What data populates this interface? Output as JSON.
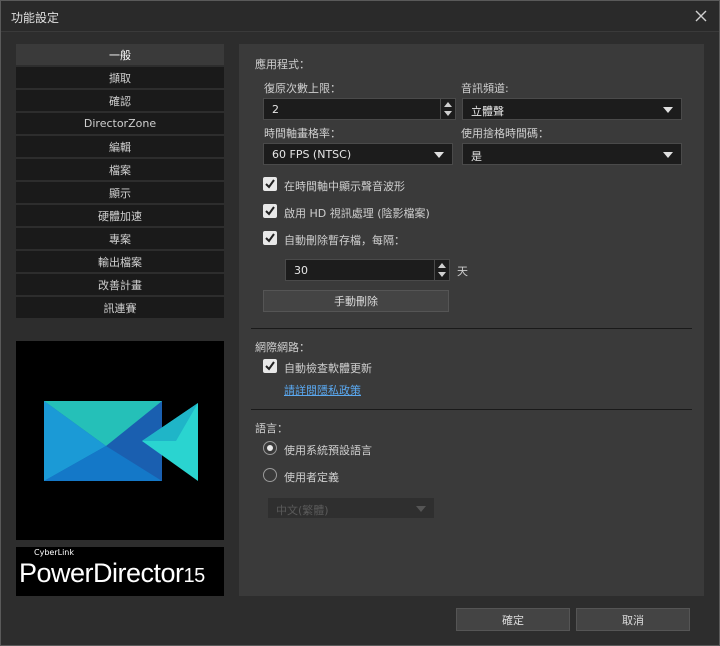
{
  "window": {
    "title": "功能設定"
  },
  "sidebar": {
    "items": [
      {
        "label": "一般",
        "active": true
      },
      {
        "label": "擷取"
      },
      {
        "label": "確認"
      },
      {
        "label": "DirectorZone"
      },
      {
        "label": "編輯"
      },
      {
        "label": "檔案"
      },
      {
        "label": "顯示"
      },
      {
        "label": "硬體加速"
      },
      {
        "label": "專案"
      },
      {
        "label": "輸出檔案"
      },
      {
        "label": "改善計畫"
      },
      {
        "label": "訊連賽"
      }
    ]
  },
  "brand": {
    "small": "CyberLink",
    "main": "PowerDirector",
    "version": "15"
  },
  "application": {
    "section_label": "應用程式：",
    "undo_label": "復原次數上限：",
    "undo_value": "2",
    "audio_label": "音訊頻道:",
    "audio_value": "立體聲",
    "fps_label": "時間軸畫格率：",
    "fps_value": "60 FPS (NTSC)",
    "dropframe_label": "使用捨格時間碼：",
    "dropframe_value": "是",
    "waveform_label": "在時間軸中顯示聲音波形",
    "hd_label": "啟用 HD 視訊處理 (陰影檔案)",
    "autodelete_label": "自動刪除暫存檔，每隔：",
    "days_value": "30",
    "days_unit": "天",
    "manual_delete": "手動刪除"
  },
  "internet": {
    "section_label": "網際網路：",
    "update_label": "自動檢查軟體更新",
    "privacy_link": "請詳閱隱私政策"
  },
  "language": {
    "section_label": "語言：",
    "system_default": "使用系統預設語言",
    "user_defined": "使用者定義",
    "lang_value": "中文(繁體)"
  },
  "footer": {
    "ok": "確定",
    "cancel": "取消"
  },
  "colors": {
    "panel": "#3a3a3a",
    "link": "#5aa8f0",
    "background": "#2d2d2d"
  }
}
